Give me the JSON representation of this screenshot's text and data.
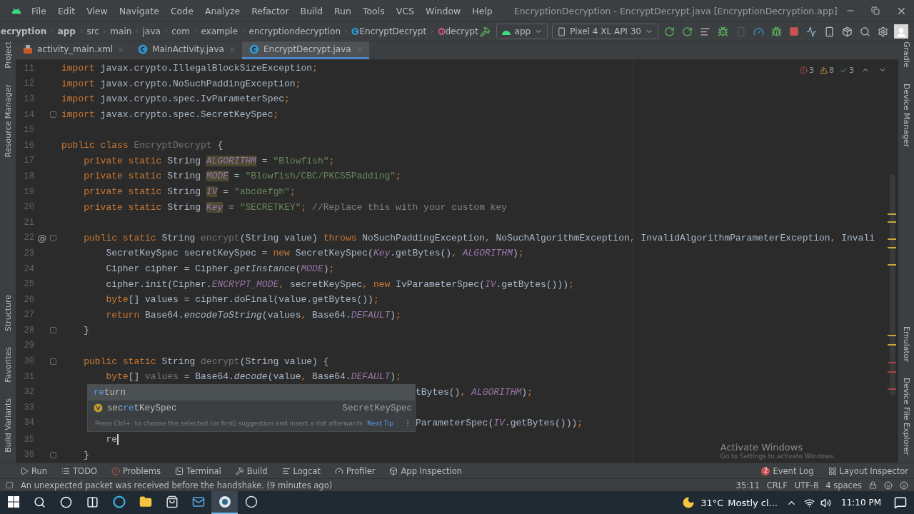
{
  "menu_bar": {
    "items": [
      "File",
      "Edit",
      "View",
      "Navigate",
      "Code",
      "Analyze",
      "Refactor",
      "Build",
      "Run",
      "Tools",
      "VCS",
      "Window",
      "Help"
    ],
    "title": "EncryptionDecryption - EncryptDecrypt.java [EncryptionDecryption.app]"
  },
  "breadcrumbs": [
    {
      "label": "ecryption",
      "kind": "project"
    },
    {
      "label": "app",
      "kind": "module"
    },
    {
      "label": "src",
      "kind": "folder"
    },
    {
      "label": "main",
      "kind": "folder"
    },
    {
      "label": "java",
      "kind": "folder"
    },
    {
      "label": "com",
      "kind": "folder"
    },
    {
      "label": "example",
      "kind": "folder"
    },
    {
      "label": "encryptiondecryption",
      "kind": "folder"
    },
    {
      "label": "EncryptDecrypt",
      "kind": "class"
    },
    {
      "label": "decrypt",
      "kind": "method"
    }
  ],
  "run_config": {
    "module": "app",
    "device": "Pixel 4 XL API 30"
  },
  "editor_tabs": [
    {
      "label": "activity_main.xml",
      "kind": "xml",
      "selected": false
    },
    {
      "label": "MainActivity.java",
      "kind": "class",
      "selected": false
    },
    {
      "label": "EncryptDecrypt.java",
      "kind": "class",
      "selected": true
    }
  ],
  "left_tool_strip": {
    "top": [
      "Project",
      "Resource Manager"
    ],
    "bottom": [
      "Structure",
      "Favorites",
      "Build Variants"
    ]
  },
  "right_tool_strip": {
    "top": [
      "Gradle",
      "Device Manager"
    ],
    "bottom": [
      "Emulator",
      "Device File Explorer"
    ]
  },
  "inspections": {
    "errors": "3",
    "warnings": "8",
    "typos": "3"
  },
  "code_lines": [
    {
      "number": "11",
      "tokens": [
        {
          "kind": "kw",
          "text": "import "
        },
        {
          "kind": "id",
          "text": "javax.crypto.IllegalBlockSizeException"
        },
        {
          "kind": "p",
          "text": ";"
        }
      ]
    },
    {
      "number": "12",
      "tokens": [
        {
          "kind": "kw",
          "text": "import "
        },
        {
          "kind": "id",
          "text": "javax.crypto.NoSuchPaddingException"
        },
        {
          "kind": "p",
          "text": ";"
        }
      ]
    },
    {
      "number": "13",
      "tokens": [
        {
          "kind": "kw",
          "text": "import "
        },
        {
          "kind": "id",
          "text": "javax.crypto.spec.IvParameterSpec"
        },
        {
          "kind": "p",
          "text": ";"
        }
      ]
    },
    {
      "number": "14",
      "fold": true,
      "tokens": [
        {
          "kind": "kw",
          "text": "import "
        },
        {
          "kind": "id",
          "text": "javax.crypto.spec.SecretKeySpec"
        },
        {
          "kind": "p",
          "text": ";"
        }
      ]
    },
    {
      "number": "15"
    },
    {
      "number": "16",
      "tokens": [
        {
          "kind": "kw",
          "text": "public class "
        },
        {
          "kind": "dim",
          "text": "EncryptDecrypt"
        },
        {
          "kind": "id",
          "text": " {"
        }
      ]
    },
    {
      "number": "17",
      "tokens": [
        {
          "kind": "kw",
          "text": "    private static "
        },
        {
          "kind": "id",
          "text": "String "
        },
        {
          "kind": "fldd",
          "text": "ALGORITHM"
        },
        {
          "kind": "id",
          "text": " = "
        },
        {
          "kind": "str",
          "text": "\"Blowfish\""
        },
        {
          "kind": "p",
          "text": ";"
        }
      ]
    },
    {
      "number": "18",
      "tokens": [
        {
          "kind": "kw",
          "text": "    private static "
        },
        {
          "kind": "id",
          "text": "String "
        },
        {
          "kind": "fldd",
          "text": "MODE"
        },
        {
          "kind": "id",
          "text": " = "
        },
        {
          "kind": "str",
          "text": "\"Blowfish/CBC/PKCS5Padding\""
        },
        {
          "kind": "p",
          "text": ";"
        }
      ]
    },
    {
      "number": "19",
      "tokens": [
        {
          "kind": "kw",
          "text": "    private static "
        },
        {
          "kind": "id",
          "text": "String "
        },
        {
          "kind": "fldd",
          "text": "IV"
        },
        {
          "kind": "id",
          "text": " = "
        },
        {
          "kind": "str",
          "text": "\"abcdefgh\""
        },
        {
          "kind": "p",
          "text": ";"
        }
      ]
    },
    {
      "number": "20",
      "tokens": [
        {
          "kind": "kw",
          "text": "    private static "
        },
        {
          "kind": "id",
          "text": "String "
        },
        {
          "kind": "fldd",
          "text": "Key"
        },
        {
          "kind": "id",
          "text": " = "
        },
        {
          "kind": "str",
          "text": "\"SECRETKEY\""
        },
        {
          "kind": "p",
          "text": ";"
        },
        {
          "kind": "cmt",
          "text": " //Replace this with your custom key"
        }
      ]
    },
    {
      "number": "21"
    },
    {
      "number": "22",
      "annotation": "@",
      "fold": true,
      "tokens": [
        {
          "kind": "kw",
          "text": "    public static "
        },
        {
          "kind": "id",
          "text": "String "
        },
        {
          "kind": "dim",
          "text": "encrypt"
        },
        {
          "kind": "id",
          "text": "(String value) "
        },
        {
          "kind": "kw",
          "text": "throws "
        },
        {
          "kind": "id",
          "text": "NoSuchPaddingException"
        },
        {
          "kind": "p",
          "text": ", "
        },
        {
          "kind": "id",
          "text": "NoSuchAlgorithmException"
        },
        {
          "kind": "p",
          "text": ", "
        },
        {
          "kind": "id",
          "text": "InvalidAlgorithmParameterException"
        },
        {
          "kind": "p",
          "text": ", "
        },
        {
          "kind": "id",
          "text": "Invali"
        }
      ]
    },
    {
      "number": "23",
      "tokens": [
        {
          "kind": "id",
          "text": "        SecretKeySpec secretKeySpec = "
        },
        {
          "kind": "kw",
          "text": "new "
        },
        {
          "kind": "id",
          "text": "SecretKeySpec("
        },
        {
          "kind": "fld",
          "text": "Key"
        },
        {
          "kind": "id",
          "text": ".getBytes()"
        },
        {
          "kind": "p",
          "text": ", "
        },
        {
          "kind": "fld",
          "text": "ALGORITHM"
        },
        {
          "kind": "id",
          "text": ")"
        },
        {
          "kind": "p",
          "text": ";"
        }
      ]
    },
    {
      "number": "24",
      "tokens": [
        {
          "kind": "id",
          "text": "        Cipher cipher = Cipher."
        },
        {
          "kind": "call",
          "text": "getInstance"
        },
        {
          "kind": "id",
          "text": "("
        },
        {
          "kind": "fld",
          "text": "MODE"
        },
        {
          "kind": "id",
          "text": ")"
        },
        {
          "kind": "p",
          "text": ";"
        }
      ]
    },
    {
      "number": "25",
      "tokens": [
        {
          "kind": "id",
          "text": "        cipher.init(Cipher."
        },
        {
          "kind": "fld",
          "text": "ENCRYPT_MODE"
        },
        {
          "kind": "p",
          "text": ", "
        },
        {
          "kind": "id",
          "text": "secretKeySpec"
        },
        {
          "kind": "p",
          "text": ", "
        },
        {
          "kind": "kw",
          "text": "new "
        },
        {
          "kind": "id",
          "text": "IvParameterSpec("
        },
        {
          "kind": "fld",
          "text": "IV"
        },
        {
          "kind": "id",
          "text": ".getBytes()))"
        },
        {
          "kind": "p",
          "text": ";"
        }
      ]
    },
    {
      "number": "26",
      "tokens": [
        {
          "kind": "kw",
          "text": "        byte"
        },
        {
          "kind": "id",
          "text": "[] values = cipher.doFinal(value.getBytes())"
        },
        {
          "kind": "p",
          "text": ";"
        }
      ]
    },
    {
      "number": "27",
      "tokens": [
        {
          "kind": "kw",
          "text": "        return "
        },
        {
          "kind": "id",
          "text": "Base64."
        },
        {
          "kind": "call",
          "text": "encodeToString"
        },
        {
          "kind": "id",
          "text": "(values"
        },
        {
          "kind": "p",
          "text": ", "
        },
        {
          "kind": "id",
          "text": "Base64."
        },
        {
          "kind": "fld",
          "text": "DEFAULT"
        },
        {
          "kind": "id",
          "text": ")"
        },
        {
          "kind": "p",
          "text": ";"
        }
      ]
    },
    {
      "number": "28",
      "fold": true,
      "tokens": [
        {
          "kind": "id",
          "text": "    }"
        }
      ]
    },
    {
      "number": "29"
    },
    {
      "number": "30",
      "fold": true,
      "tokens": [
        {
          "kind": "kw",
          "text": "    public static "
        },
        {
          "kind": "id",
          "text": "String "
        },
        {
          "kind": "dim",
          "text": "decrypt"
        },
        {
          "kind": "id",
          "text": "(String value) {"
        }
      ]
    },
    {
      "number": "31",
      "tokens": [
        {
          "kind": "kw",
          "text": "        byte"
        },
        {
          "kind": "id",
          "text": "[] "
        },
        {
          "kind": "dim",
          "text": "values"
        },
        {
          "kind": "id",
          "text": " = Base64."
        },
        {
          "kind": "call",
          "text": "decode"
        },
        {
          "kind": "id",
          "text": "(value"
        },
        {
          "kind": "p",
          "text": ", "
        },
        {
          "kind": "id",
          "text": "Base64."
        },
        {
          "kind": "fld",
          "text": "DEFAULT"
        },
        {
          "kind": "id",
          "text": ")"
        },
        {
          "kind": "p",
          "text": ";"
        }
      ]
    },
    {
      "number": "32",
      "under_popup": true,
      "tokens": [
        {
          "kind": "id",
          "text": "tBytes()"
        },
        {
          "kind": "p",
          "text": ", "
        },
        {
          "kind": "fld",
          "text": "ALGORITHM"
        },
        {
          "kind": "id",
          "text": ")"
        },
        {
          "kind": "p",
          "text": ";"
        }
      ]
    },
    {
      "number": "33",
      "under_popup": true
    },
    {
      "number": "34",
      "under_popup": true,
      "tokens": [
        {
          "kind": "id",
          "text": "ParameterSpec("
        },
        {
          "kind": "fld",
          "text": "IV"
        },
        {
          "kind": "id",
          "text": ".getBytes()))"
        },
        {
          "kind": "p",
          "text": ";"
        }
      ]
    },
    {
      "number": "35",
      "caret": true,
      "tokens": [
        {
          "kind": "id",
          "text": "        re"
        }
      ]
    },
    {
      "number": "36",
      "fold": true,
      "tokens": [
        {
          "kind": "id",
          "text": "    }"
        }
      ]
    }
  ],
  "completion_popup": {
    "items": [
      {
        "kind": "keyword",
        "match": "re",
        "rest": "turn",
        "selected": true
      },
      {
        "kind": "variable",
        "prefix": "sec",
        "match": "re",
        "rest": "tKeySpec",
        "type": "SecretKeySpec",
        "selected": false
      }
    ],
    "hint": "Press Ctrl+. to choose the selected (or first) suggestion and insert a dot afterwards",
    "hint_link": "Next Tip"
  },
  "activation_notice": {
    "title": "Activate Windows",
    "subtitle": "Go to Settings to activate Windows."
  },
  "tool_windows": [
    {
      "label": "Run",
      "kind": "run"
    },
    {
      "label": "TODO",
      "kind": "todo"
    },
    {
      "label": "Problems",
      "kind": "problems"
    },
    {
      "label": "Terminal",
      "kind": "terminal"
    },
    {
      "label": "Build",
      "kind": "build"
    },
    {
      "label": "Logcat",
      "kind": "logcat"
    },
    {
      "label": "Profiler",
      "kind": "profiler"
    },
    {
      "label": "App Inspection",
      "kind": "inspection"
    }
  ],
  "tool_windows_right": [
    {
      "label": "Event Log",
      "kind": "event",
      "badge": "2"
    },
    {
      "label": "Layout Inspector",
      "kind": "layout"
    }
  ],
  "status_bar": {
    "message": "An unexpected packet was received before the handshake. (9 minutes ago)",
    "position": "35:11",
    "line_ending": "CRLF",
    "encoding": "UTF-8",
    "indent": "4 spaces"
  },
  "taskbar": {
    "apps": [
      {
        "kind": "edge",
        "selected": false
      },
      {
        "kind": "explorer",
        "selected": false
      },
      {
        "kind": "store",
        "selected": false
      },
      {
        "kind": "mail",
        "selected": false
      },
      {
        "kind": "studio",
        "selected": true
      },
      {
        "kind": "recorder",
        "selected": false
      }
    ],
    "temperature": "31°C",
    "weather": "Mostly cl...",
    "time": "11:10 PM"
  }
}
